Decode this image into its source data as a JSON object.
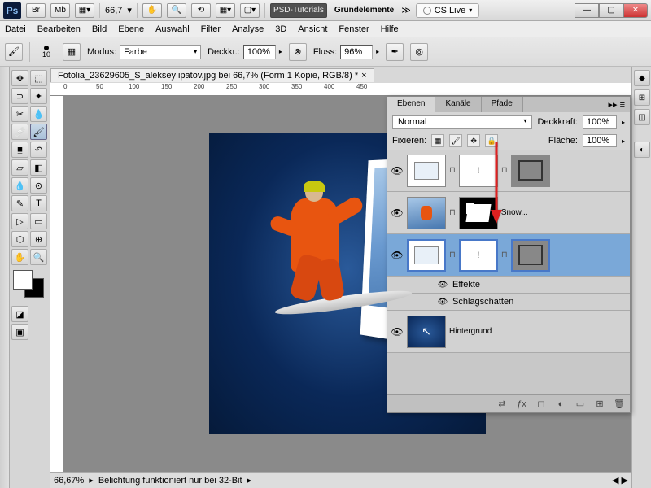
{
  "titlebar": {
    "app": "Ps",
    "badges": [
      "Br",
      "Mb"
    ],
    "zoom": "66,7",
    "psd_tutorials": "PSD-Tutorials",
    "grundelemente": "Grundelemente",
    "cslive": "CS Live"
  },
  "menubar": [
    "Datei",
    "Bearbeiten",
    "Bild",
    "Ebene",
    "Auswahl",
    "Filter",
    "Analyse",
    "3D",
    "Ansicht",
    "Fenster",
    "Hilfe"
  ],
  "optionsbar": {
    "brush_size": "10",
    "modus_label": "Modus:",
    "modus_value": "Farbe",
    "deckkr_label": "Deckkr.:",
    "deckkr_value": "100%",
    "fluss_label": "Fluss:",
    "fluss_value": "96%"
  },
  "document": {
    "tab": "Fotolia_23629605_S_aleksey ipatov.jpg bei 66,7% (Form 1 Kopie, RGB/8) *",
    "ruler_marks": [
      "0",
      "50",
      "100",
      "150",
      "200",
      "250",
      "300",
      "350",
      "400",
      "450"
    ]
  },
  "statusbar": {
    "zoom": "66,67%",
    "msg": "Belichtung funktioniert nur bei 32-Bit"
  },
  "layers_panel": {
    "tabs": [
      "Ebenen",
      "Kanäle",
      "Pfade"
    ],
    "blend_label": "Normal",
    "opacity_label": "Deckkraft:",
    "opacity_value": "100%",
    "lock_label": "Fixieren:",
    "fill_label": "Fläche:",
    "fill_value": "100%",
    "layers": [
      {
        "name": "",
        "thumb": "shape",
        "mask": true
      },
      {
        "name": "Snow...",
        "thumb": "photo",
        "mask": true
      },
      {
        "name": "",
        "thumb": "shape",
        "mask": true,
        "selected": true
      },
      {
        "name": "Hintergrund",
        "thumb": "bg"
      }
    ],
    "effects_label": "Effekte",
    "shadow_label": "Schlagschatten"
  }
}
